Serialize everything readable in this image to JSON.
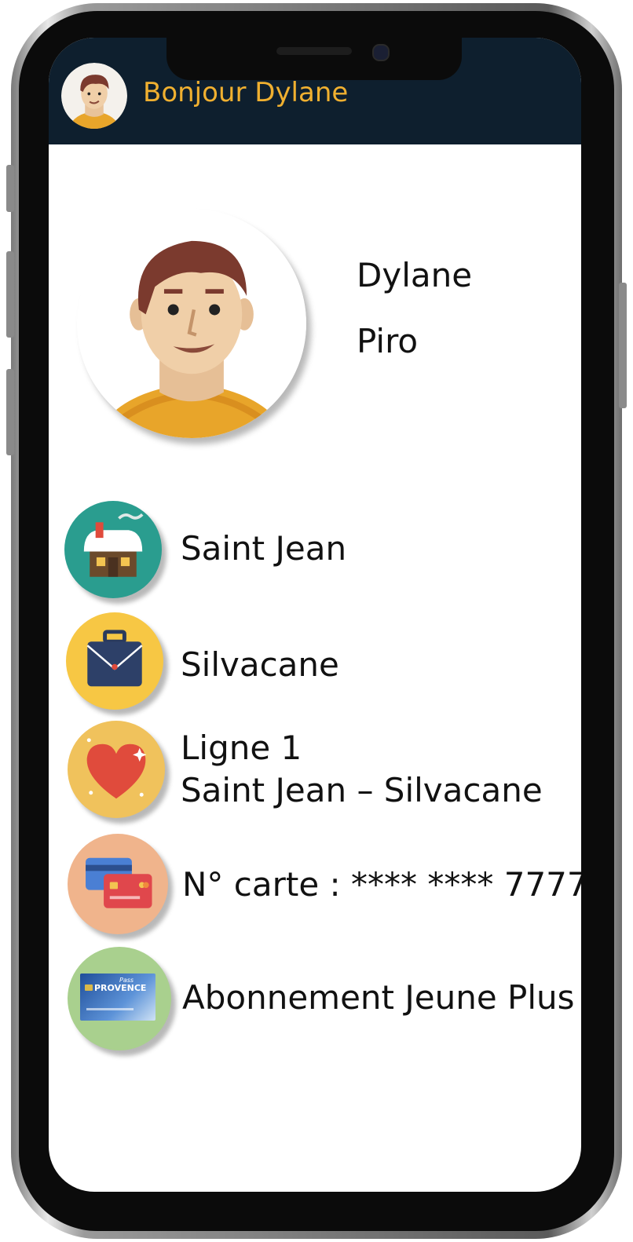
{
  "header": {
    "greeting": "Bonjour Dylane"
  },
  "profile": {
    "first_name": "Dylane",
    "last_name": "Piro"
  },
  "items": [
    {
      "icon": "home-icon",
      "label": "Saint Jean"
    },
    {
      "icon": "briefcase-icon",
      "label": "Silvacane"
    },
    {
      "icon": "heart-icon",
      "label": "Ligne 1",
      "sub_label": "Saint Jean – Silvacane"
    },
    {
      "icon": "credit-card-icon",
      "label": "N° carte : **** **** 7777"
    },
    {
      "icon": "pass-card-icon",
      "label": "Abonnement Jeune Plus",
      "icon_text": "PROVENCE",
      "icon_text_small": "Pass"
    }
  ],
  "colors": {
    "header_bg": "#0e1f2e",
    "greeting": "#f0b030",
    "home_bg": "#2a9d8f",
    "briefcase_bg": "#f7c744",
    "heart_bg": "#f0c25c",
    "card_bg": "#f0b48c",
    "pass_bg": "#a9d08e"
  }
}
